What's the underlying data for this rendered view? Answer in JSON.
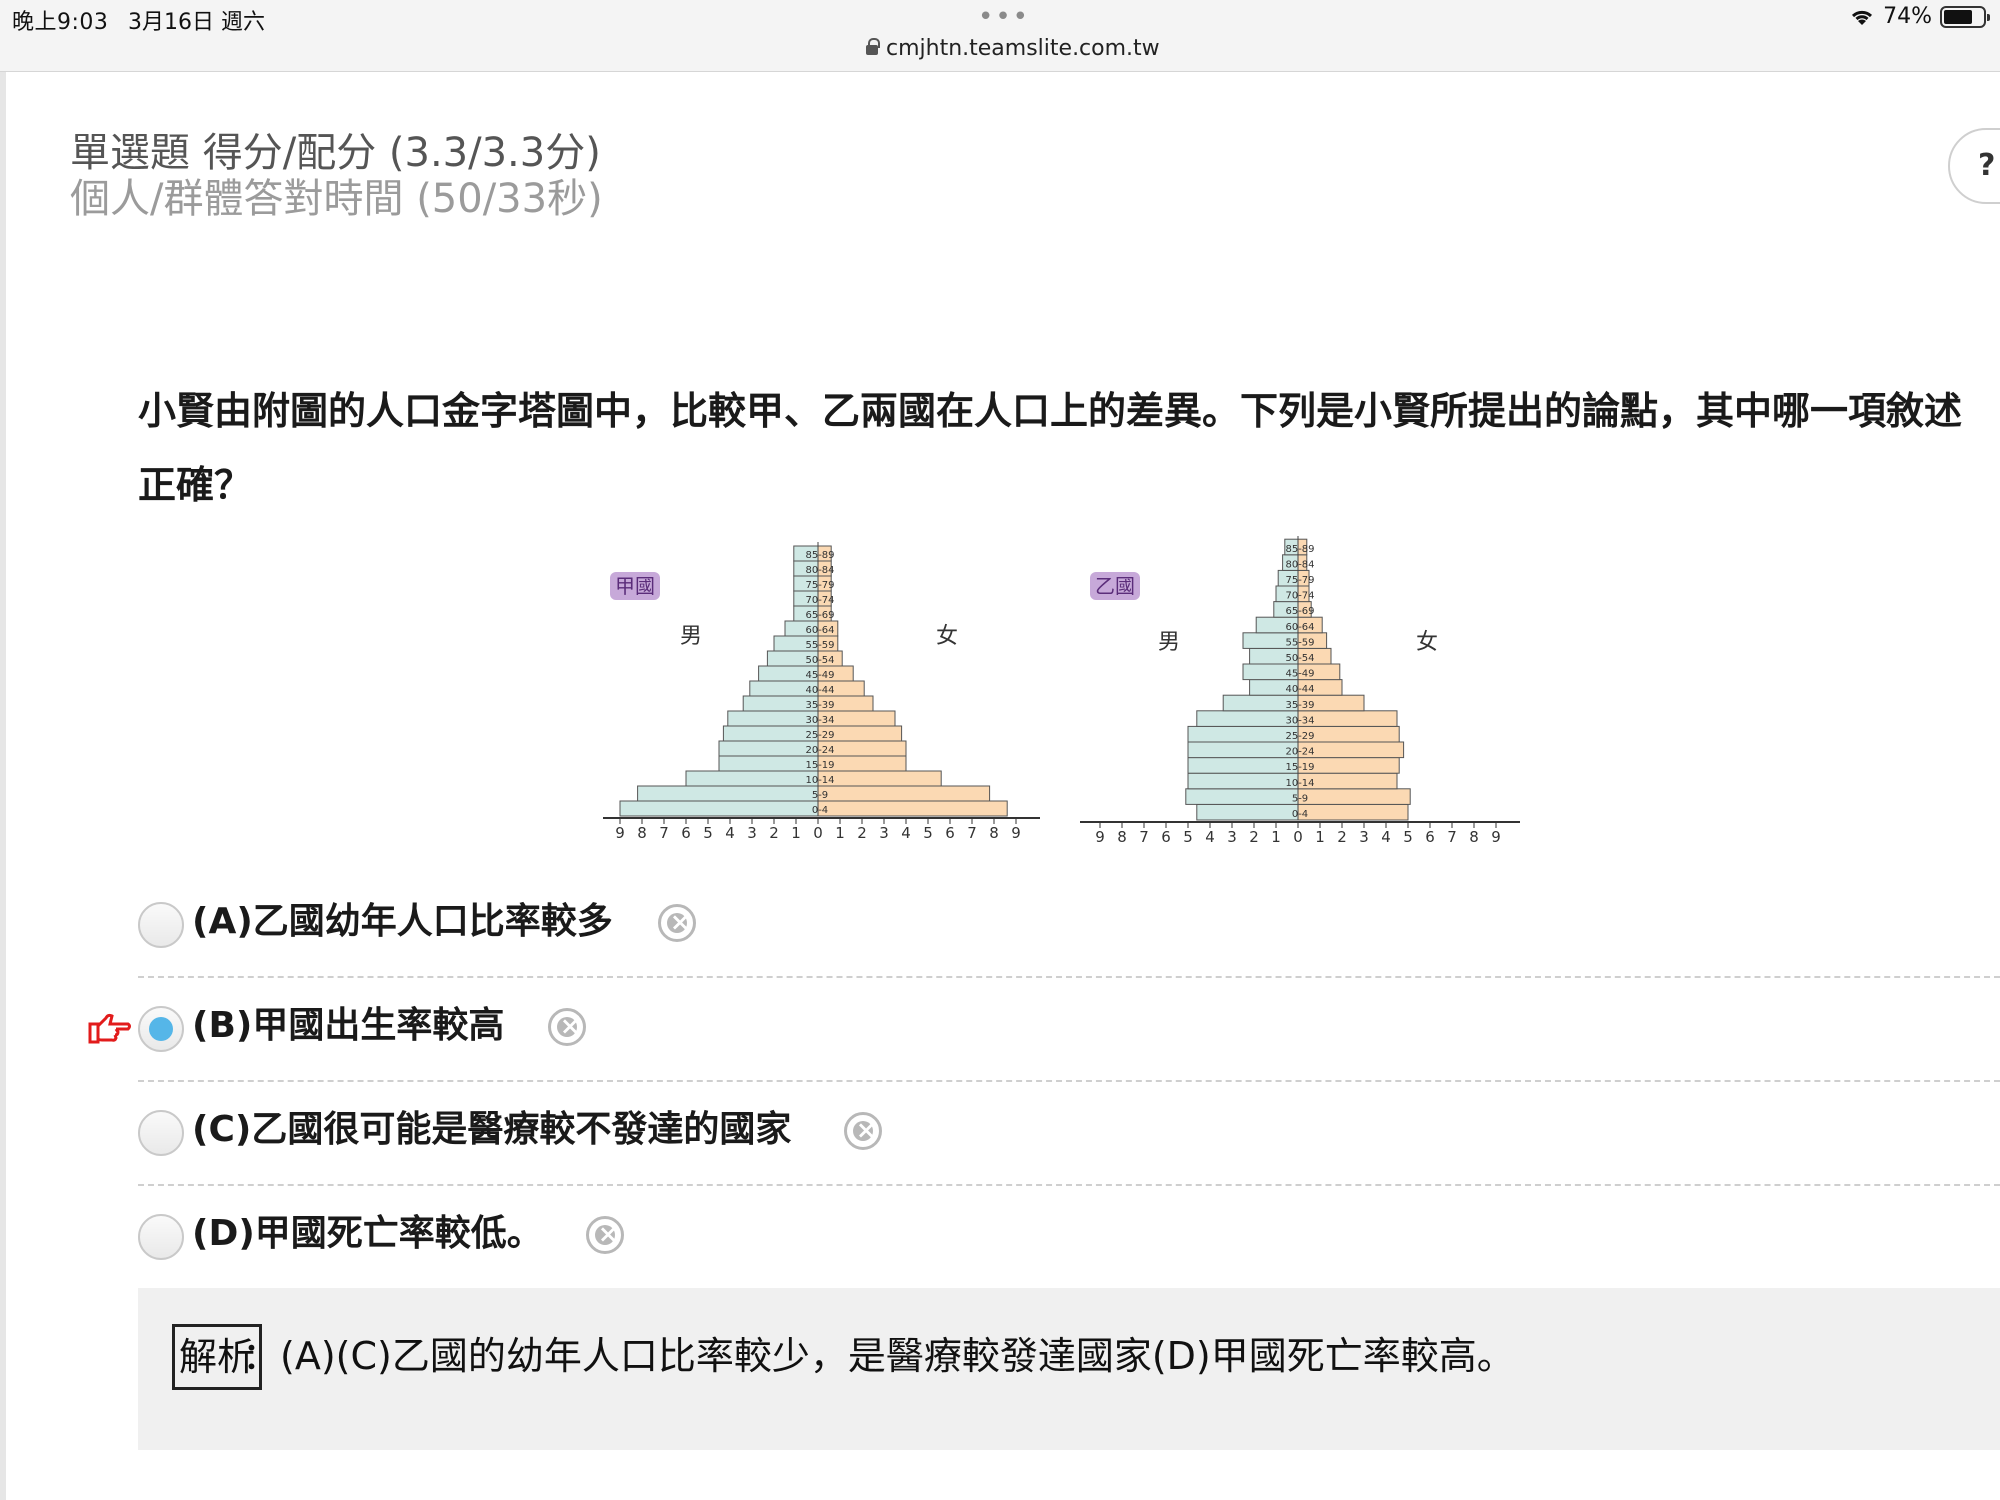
{
  "status_bar": {
    "time": "晚上9:03",
    "date": "3月16日 週六",
    "dots": "•••",
    "url": "cmjhtn.teamslite.com.tw",
    "battery": "74%",
    "battery_level": 0.74
  },
  "score": {
    "line1": "單選題 得分/配分 (3.3/3.3分)",
    "line2": "個人/群體答對時間 (50/33秒)"
  },
  "help_label": "?",
  "question": "小賢由附圖的人口金字塔圖中，比較甲、乙兩國在人口上的差異。下列是小賢所提出的論點，其中哪一項敘述正確？",
  "figure": {
    "axis_ticks": [
      "9",
      "8",
      "7",
      "6",
      "5",
      "4",
      "3",
      "2",
      "1",
      "0",
      "1",
      "2",
      "3",
      "4",
      "5",
      "6",
      "7",
      "8",
      "9"
    ],
    "age_groups": [
      "0-4",
      "5-9",
      "10-14",
      "15-19",
      "20-24",
      "25-29",
      "30-34",
      "35-39",
      "40-44",
      "45-49",
      "50-54",
      "55-59",
      "60-64",
      "65-69",
      "70-74",
      "75-79",
      "80-84",
      "85-89"
    ],
    "male_label": "男",
    "female_label": "女",
    "male_color": "#cfe8e4",
    "female_color": "#fbd9b3",
    "countries": [
      {
        "name": "甲國",
        "male": [
          9.0,
          8.2,
          6.0,
          4.5,
          4.5,
          4.3,
          4.1,
          3.4,
          3.1,
          2.7,
          2.3,
          2.0,
          1.5,
          1.1,
          1.1,
          1.1,
          1.1,
          1.1
        ],
        "female": [
          8.6,
          7.8,
          5.6,
          4.0,
          4.0,
          3.8,
          3.5,
          2.5,
          2.1,
          1.6,
          1.1,
          0.9,
          0.9,
          0.6,
          0.6,
          0.6,
          0.6,
          0.6
        ]
      },
      {
        "name": "乙國",
        "male": [
          4.6,
          5.1,
          5.0,
          5.0,
          5.0,
          5.0,
          4.6,
          3.4,
          2.2,
          2.5,
          2.2,
          2.5,
          1.9,
          1.1,
          1.0,
          0.9,
          0.7,
          0.6
        ],
        "female": [
          5.0,
          5.1,
          4.5,
          4.6,
          4.8,
          4.6,
          4.5,
          3.0,
          2.0,
          1.9,
          1.5,
          1.3,
          1.1,
          0.6,
          0.5,
          0.5,
          0.4,
          0.4
        ]
      }
    ]
  },
  "options": [
    {
      "letter": "(A)",
      "text": "乙國幼年人口比率較多",
      "selected": false
    },
    {
      "letter": "(B)",
      "text": "甲國出生率較高",
      "selected": true
    },
    {
      "letter": "(C)",
      "text": "乙國很可能是醫療較不發達的國家",
      "selected": false
    },
    {
      "letter": "(D)",
      "text": "甲國死亡率較低。",
      "selected": false
    }
  ],
  "analysis": {
    "label": "解析",
    "text": "：(A)(C)乙國的幼年人口比率較少，是醫療較發達國家(D)甲國死亡率較高。"
  }
}
